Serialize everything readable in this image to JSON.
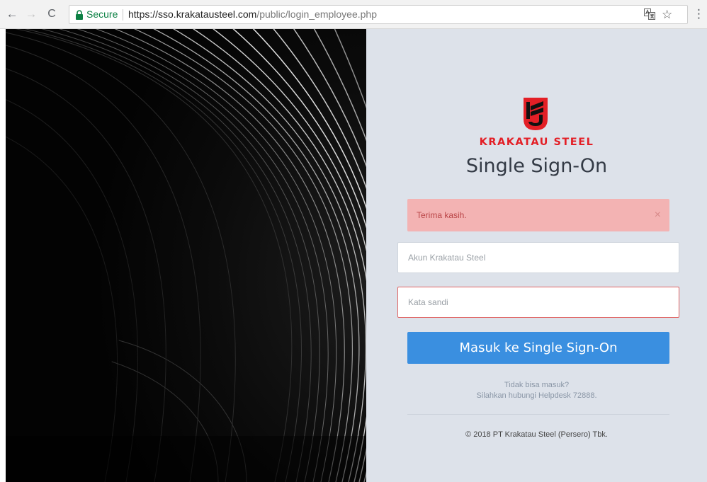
{
  "browser": {
    "secure_label": "Secure",
    "url_host": "https://sso.krakatausteel.com",
    "url_path": "/public/login_employee.php",
    "back_icon": "←",
    "forward_icon": "→",
    "reload_icon": "C",
    "star_icon": "☆",
    "menu_icon": "⋮"
  },
  "login": {
    "brand": "KRAKATAU STEEL",
    "title": "Single Sign-On",
    "alert_message": "Terima kasih.",
    "alert_close": "×",
    "username_placeholder": "Akun Krakatau Steel",
    "password_placeholder": "Kata sandi",
    "submit_label": "Masuk ke Single Sign-On",
    "help_line1": "Tidak bisa masuk?",
    "help_line2": "Silahkan hubungi Helpdesk 72888.",
    "footer": "© 2018 PT Krakatau Steel (Persero) Tbk."
  },
  "colors": {
    "brand_red": "#e31f26",
    "button_blue": "#3a8fe0",
    "alert_bg": "#f3b3b3",
    "panel_bg": "#dde2ea",
    "secure_green": "#0b8043"
  }
}
